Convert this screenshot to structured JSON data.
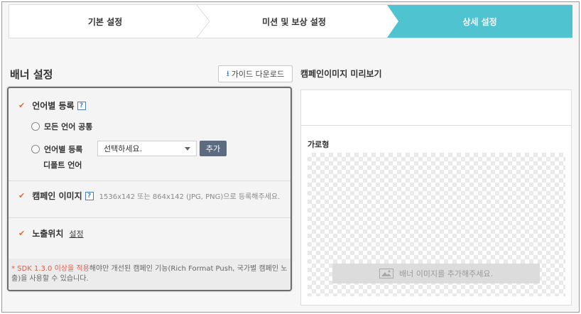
{
  "stepper": {
    "steps": [
      {
        "label": "기본 설정"
      },
      {
        "label": "미션 및 보상 설정"
      },
      {
        "label": "상세 설정"
      }
    ],
    "active_color": "#4fc3cf"
  },
  "banner": {
    "title": "배너 설정",
    "guide_button": "가이드 다운로드",
    "language": {
      "label": "언어별 등록",
      "help": "?",
      "option_all": "모든 언어 공통",
      "option_each": "언어별 등록",
      "select_placeholder": "선택하세요.",
      "add_button": "추가",
      "default_label": "디폴트 언어"
    },
    "campaign_image": {
      "label": "캠페인 이미지",
      "help": "?",
      "hint": "1536x142 또는 864x142 (JPG, PNG)으로 등록해주세요."
    },
    "position": {
      "label": "노출위치",
      "link": "설정"
    },
    "note": {
      "prefix": "* SDK 1.3.0 이상을 적용",
      "line1": "해야만 개선된 캠페인 기능(Rich Format Push, 국가별 캠페인 노",
      "line2": "출)을 사용할 수 있습니다."
    }
  },
  "preview": {
    "title": "캠페인이미지 미리보기",
    "subtitle": "가로형",
    "add_banner": "배너 이미지를 추가해주세요."
  }
}
